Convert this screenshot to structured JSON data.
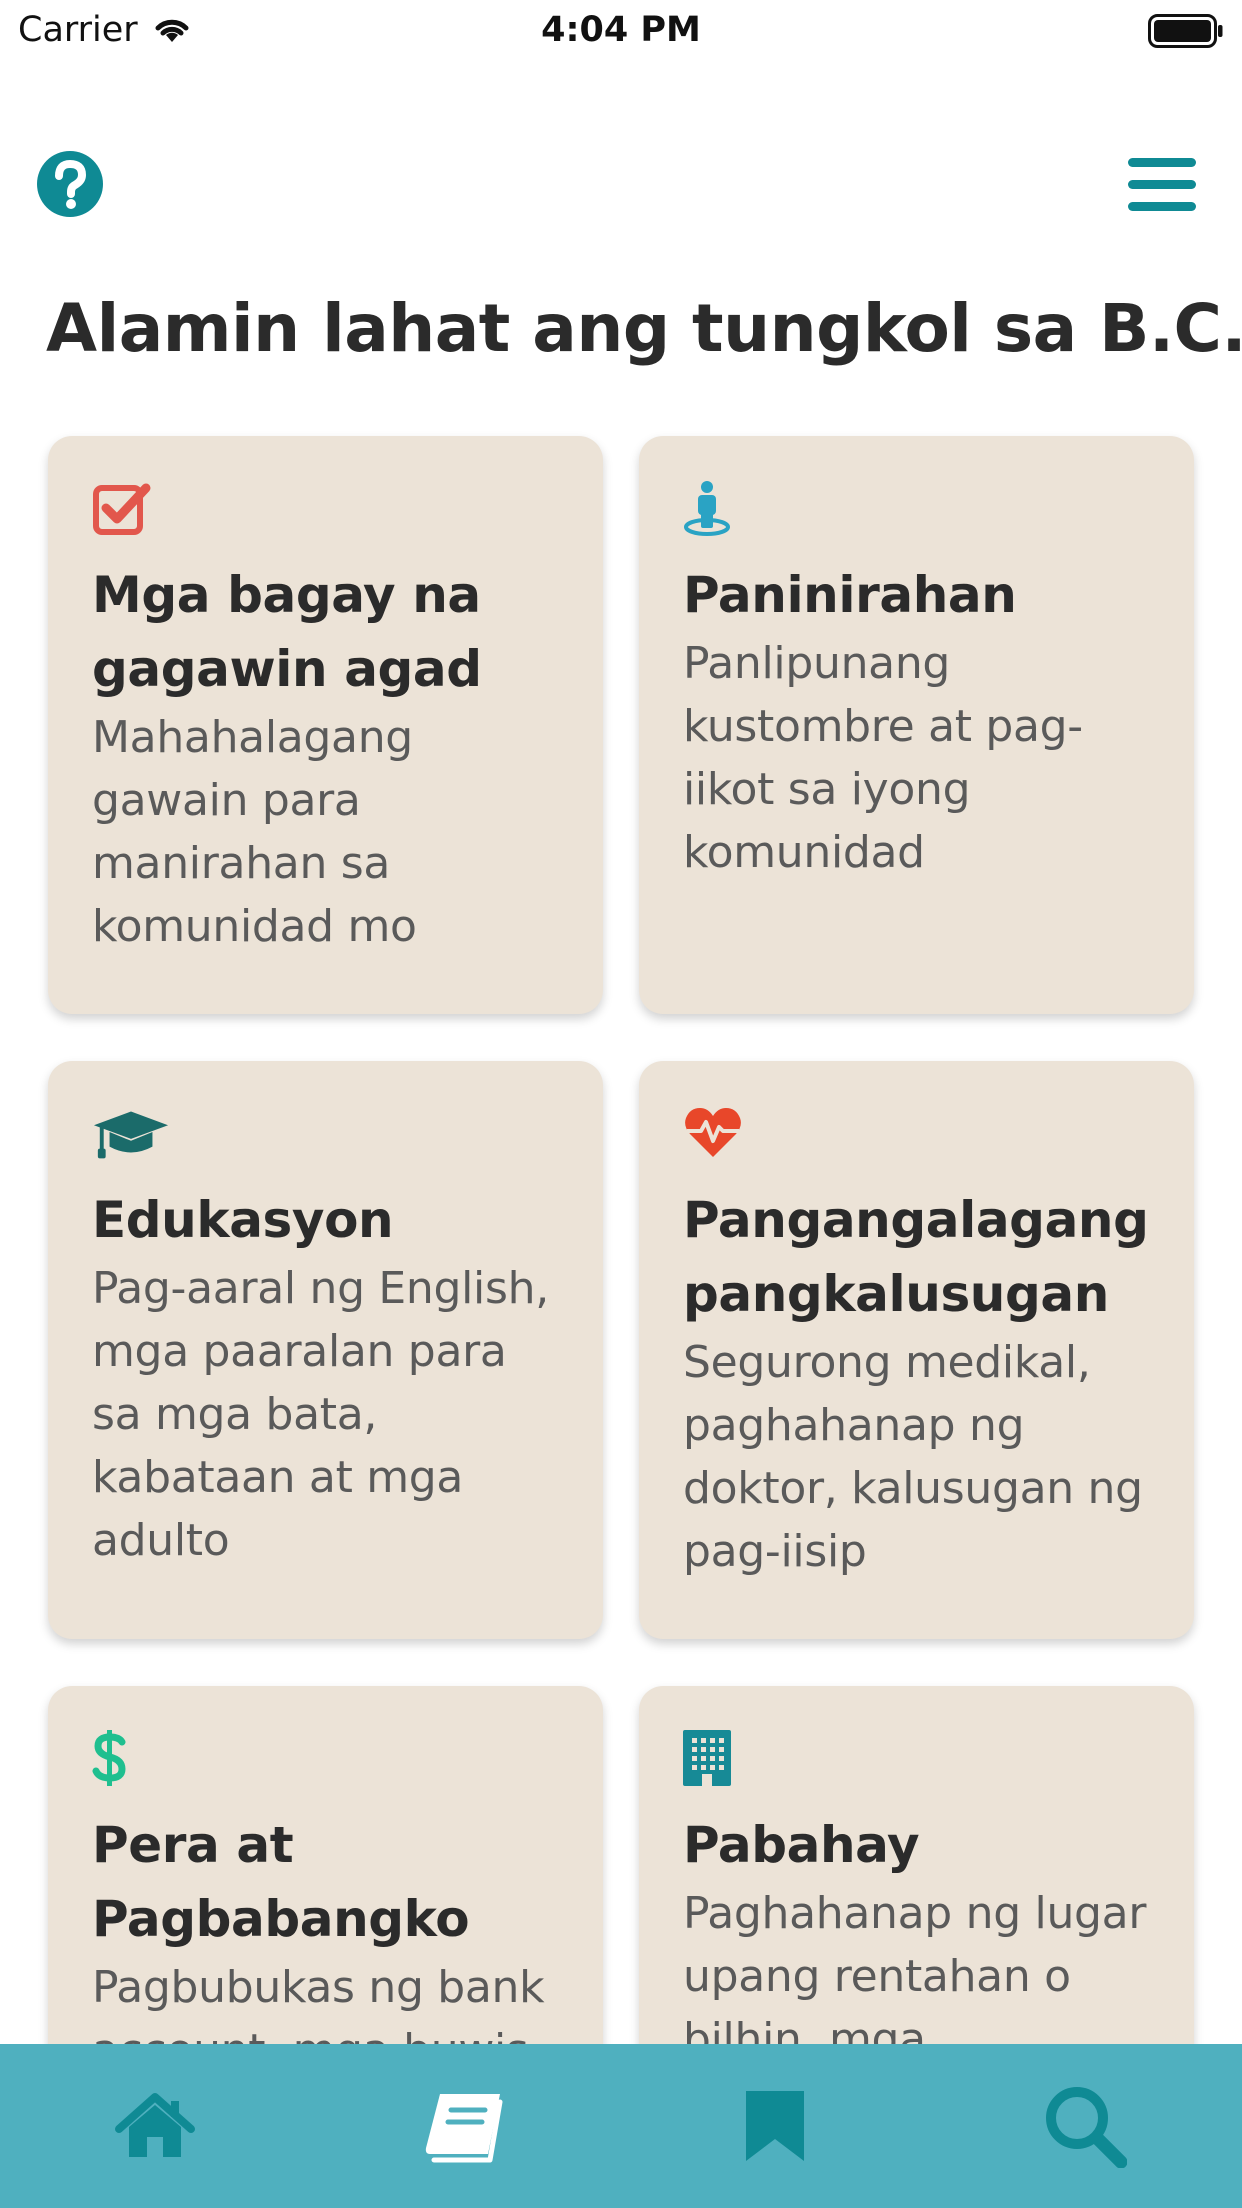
{
  "status_bar": {
    "carrier": "Carrier",
    "time": "4:04 PM"
  },
  "header": {
    "title": "Alamin lahat ang tungkol sa B.C."
  },
  "cards": [
    {
      "icon": "checkbox-icon",
      "icon_color": "#e2574c",
      "title": "Mga bagay na gagawin agad",
      "desc": "Mahahalagang gawain para manirahan sa komunidad mo"
    },
    {
      "icon": "person-location-icon",
      "icon_color": "#2aa3c4",
      "title": "Paninirahan",
      "desc": "Panlipunang kustombre at pag-iikot sa iyong komunidad"
    },
    {
      "icon": "graduation-cap-icon",
      "icon_color": "#1b6b6a",
      "title": "Edukasyon",
      "desc": "Pag-aaral ng English, mga paaralan para sa mga bata, kabataan at mga adulto"
    },
    {
      "icon": "heartbeat-icon",
      "icon_color": "#e8472a",
      "title": "Pangangalagang pangkalusugan",
      "desc": "Segurong medikal, paghahanap ng doktor, kalusugan ng pag-iisip"
    },
    {
      "icon": "dollar-icon",
      "icon_color": "#1fbf8f",
      "title": "Pera at Pagbabangko",
      "desc": "Pagbubukas ng bank account, mga buwis"
    },
    {
      "icon": "building-icon",
      "icon_color": "#178a96",
      "title": "Pabahay",
      "desc": "Paghahanap ng lugar upang rentahan o bilhin, mga karapatan"
    }
  ],
  "tab_bar": {
    "tabs": [
      {
        "name": "home",
        "icon": "home-icon",
        "active": false
      },
      {
        "name": "guide",
        "icon": "book-icon",
        "active": true
      },
      {
        "name": "bookmarks",
        "icon": "bookmark-icon",
        "active": false
      },
      {
        "name": "search",
        "icon": "search-icon",
        "active": false
      }
    ]
  },
  "colors": {
    "accent": "#0f8a94",
    "tab_bar_bg": "#4fb0bf",
    "card_bg": "#ece3d7"
  }
}
